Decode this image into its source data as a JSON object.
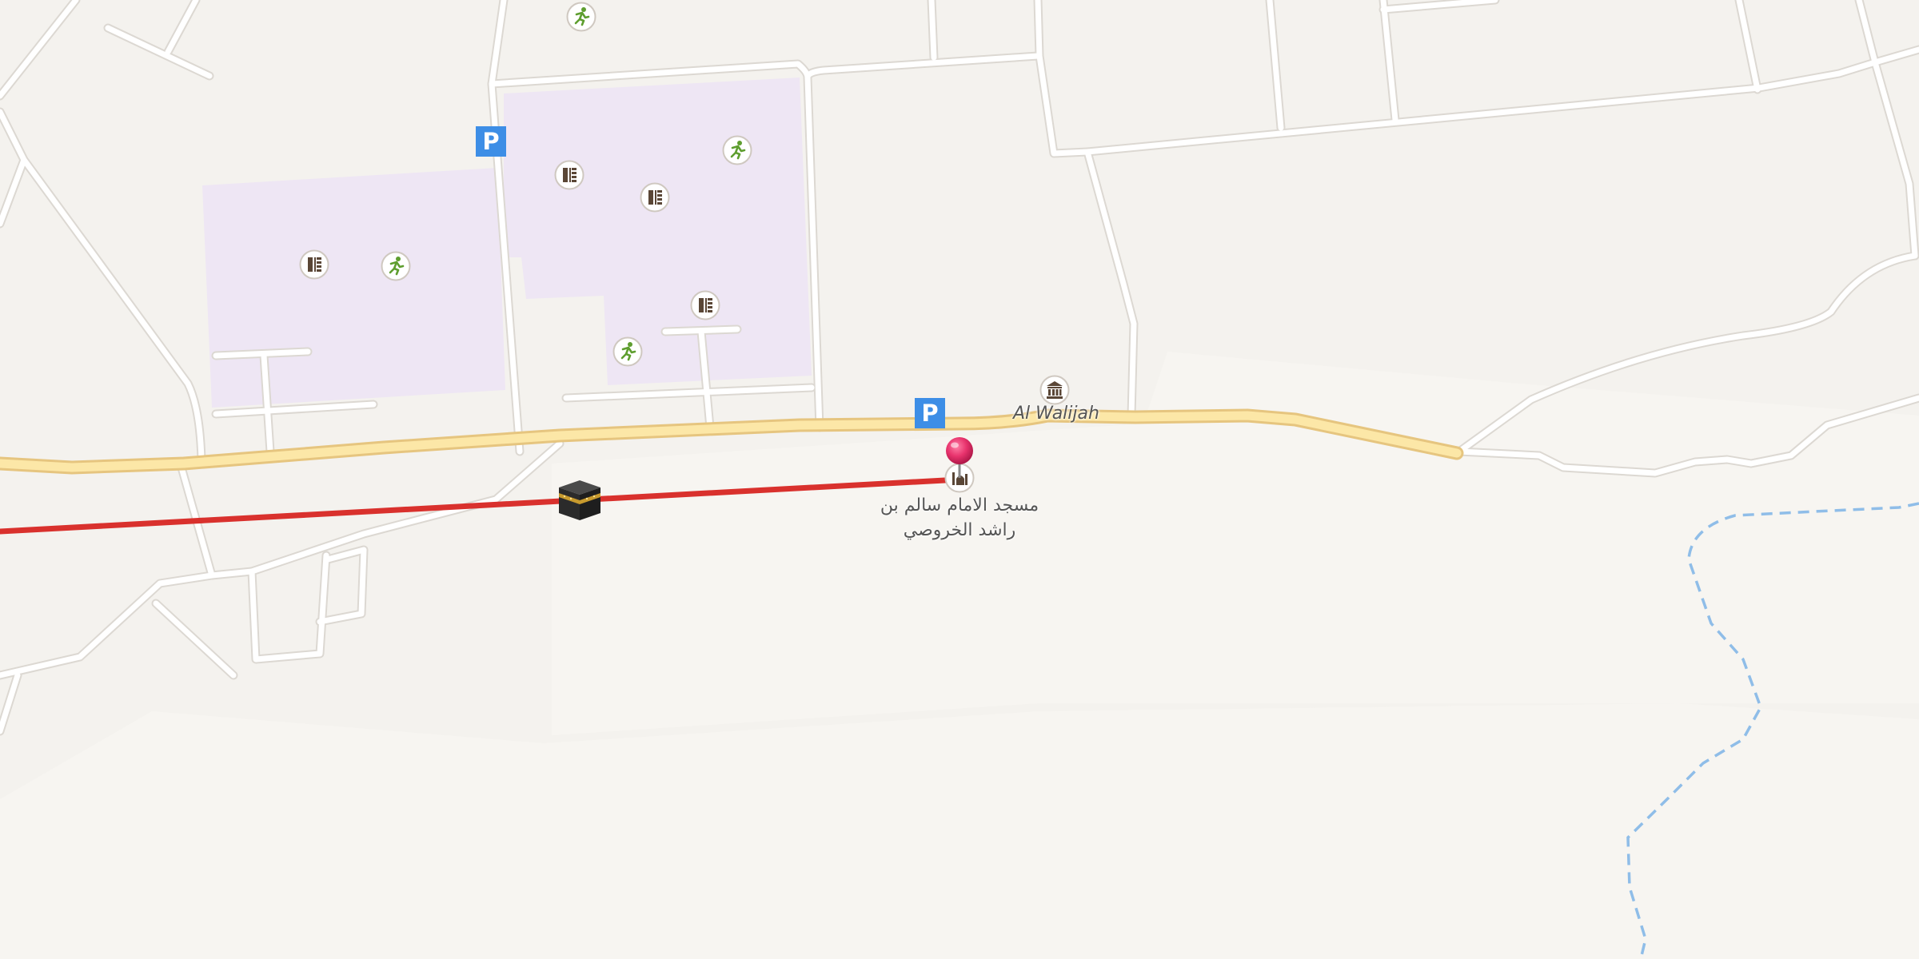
{
  "map": {
    "place_label": "Al Walijah",
    "mosque_label": "مسجد الامام سالم بن راشد الخروصي",
    "parking_glyph": "P",
    "colors": {
      "background": "#f4f2ee",
      "land_light": "#f7f5f1",
      "school_area": "#eee6f4",
      "minor_road": "#ffffff",
      "minor_road_casing": "#dcd8d2",
      "main_road_fill": "#fce7a7",
      "main_road_casing": "#e6c57f",
      "route_line": "#d9312d",
      "wadi_dashed": "#8fbde8",
      "parking": "#3d8ee6",
      "pin": "#e8336d",
      "school_icon": "#5a4636",
      "sports_icon": "#5e9e2f"
    },
    "markers": [
      {
        "type": "school-icon"
      },
      {
        "type": "school-icon"
      },
      {
        "type": "school-icon"
      },
      {
        "type": "school-icon"
      },
      {
        "type": "sports-icon"
      },
      {
        "type": "sports-icon"
      },
      {
        "type": "sports-icon"
      },
      {
        "type": "sports-icon"
      },
      {
        "type": "museum-icon"
      },
      {
        "type": "mosque-icon"
      },
      {
        "type": "kaaba-icon"
      },
      {
        "type": "parking-icon"
      },
      {
        "type": "parking-icon"
      },
      {
        "type": "location-pin-icon"
      }
    ]
  }
}
